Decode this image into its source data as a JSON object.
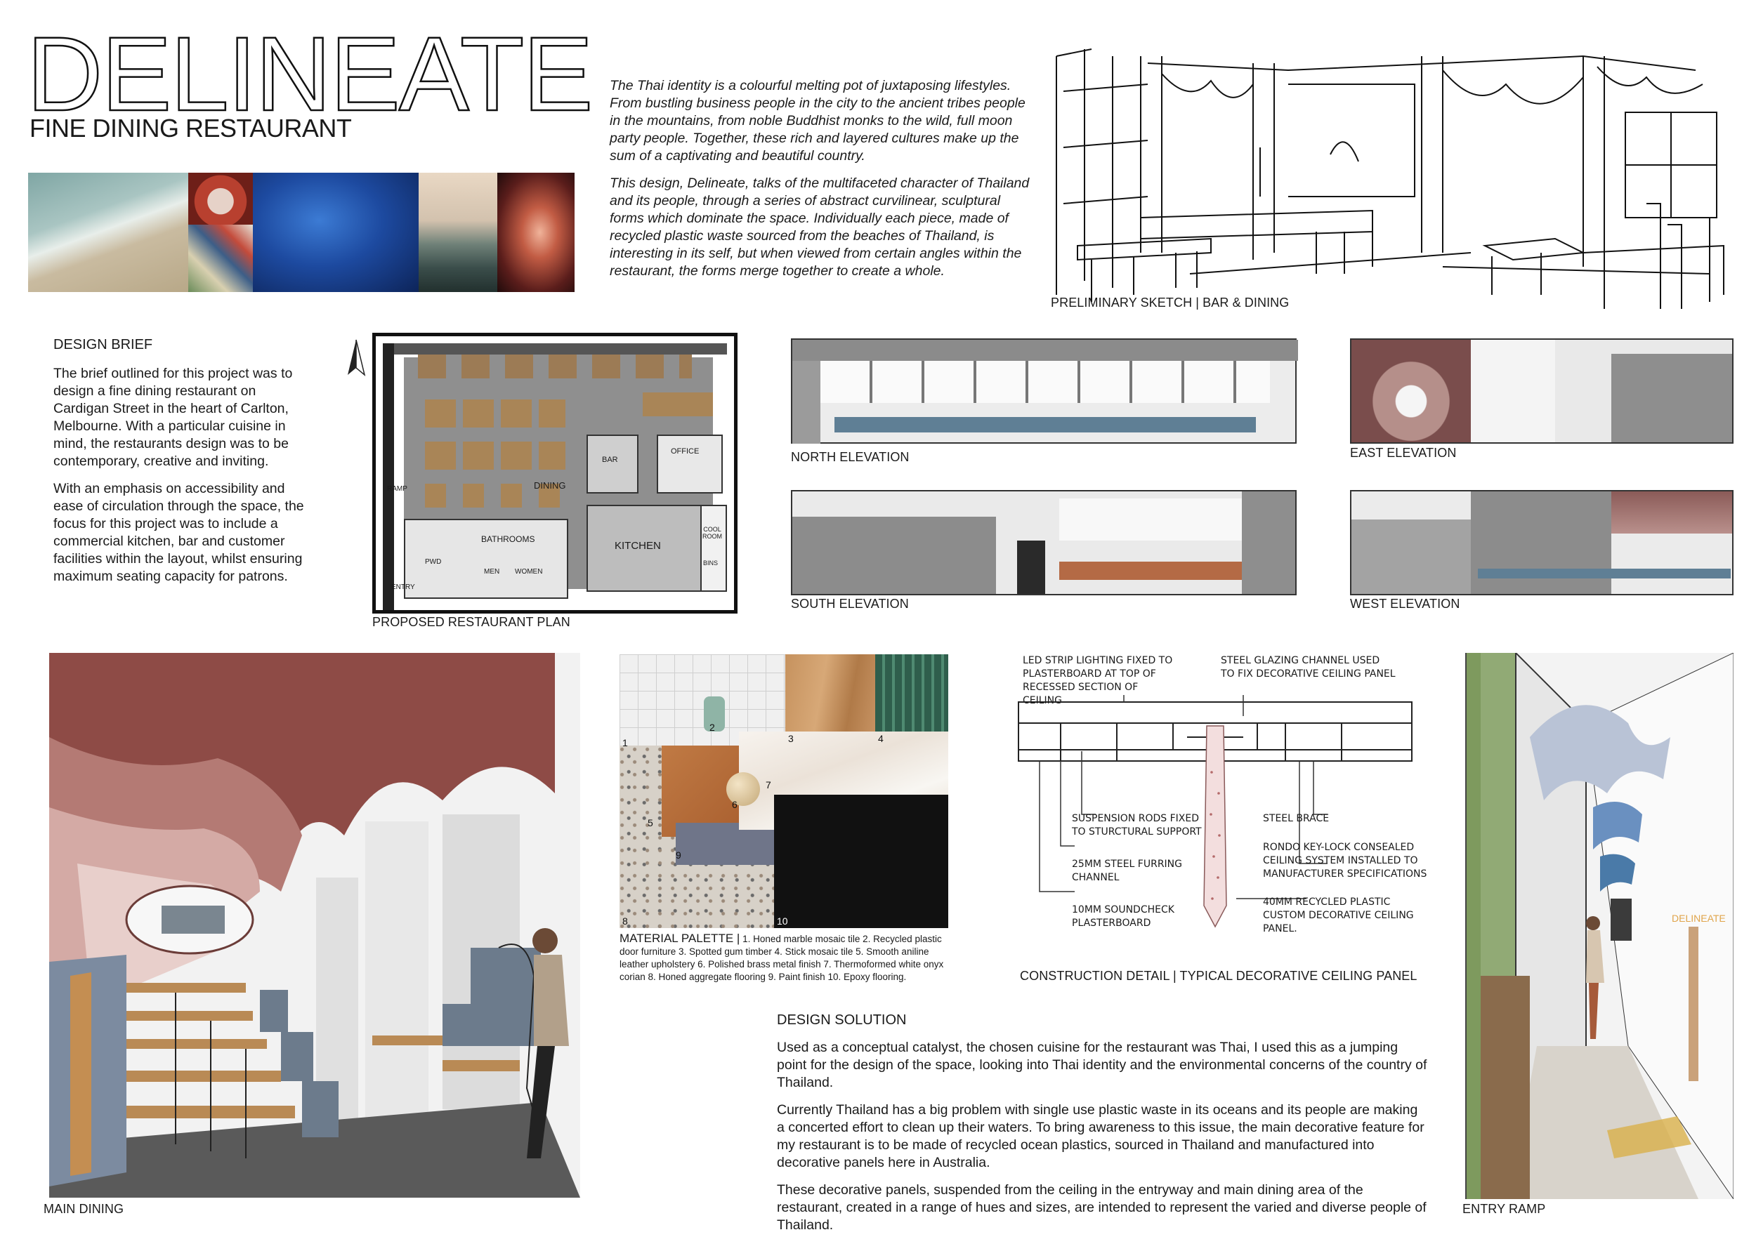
{
  "header": {
    "title": "DELINEATE",
    "subtitle": "FINE DINING RESTAURANT"
  },
  "intro": {
    "p1": "The Thai identity is a colourful melting pot of juxtaposing lifestyles. From bustling business people in the city to the ancient tribes people in the mountains, from noble Buddhist monks to the wild, full moon party people. Together, these rich and layered cultures make up the sum of a captivating and beautiful country.",
    "p2": "This design, Delineate, talks of the multifaceted character of Thailand and its people, through a series of abstract curvilinear, sculptural forms which dominate the space. Individually each piece, made of recycled plastic waste sourced from the beaches of Thailand, is interesting in its self, but when viewed from certain angles within the restaurant, the forms merge together to create a whole."
  },
  "captions": {
    "sketch": "PRELIMINARY SKETCH | BAR & DINING",
    "plan": "PROPOSED RESTAURANT PLAN",
    "north": "NORTH ELEVATION",
    "east": "EAST ELEVATION",
    "south": "SOUTH ELEVATION",
    "west": "WEST ELEVATION",
    "main_dining": "MAIN DINING",
    "entry_ramp": "ENTRY RAMP",
    "construction": "CONSTRUCTION DETAIL | TYPICAL DECORATIVE CEILING PANEL"
  },
  "brief": {
    "heading": "DESIGN BRIEF",
    "p1": "The brief outlined for this project was to design a fine dining restaurant on Cardigan Street in the heart of Carlton, Melbourne. With a particular cuisine in mind, the restaurants design was to be contemporary, creative and inviting.",
    "p2": "With an emphasis on accessibility and ease of circulation through the space, the focus for this project was to include a commercial kitchen, bar and customer facilities within the layout, whilst ensuring maximum seating capacity for patrons."
  },
  "plan_labels": {
    "bar": "BAR",
    "office": "OFFICE",
    "dining": "DINING",
    "ramp": "RAMP",
    "bathrooms": "BATHROOMS",
    "kitchen": "KITCHEN",
    "pwd": "PWD",
    "men": "MEN",
    "women": "WOMEN",
    "entry": "ENTRY",
    "coolroom": "COOL ROOM",
    "bins": "BINS"
  },
  "materials": {
    "heading": "MATERIAL PALETTE |",
    "text": "1. Honed marble mosaic tile 2. Recycled plastic door furniture 3. Spotted gum timber 4. Stick mosaic tile 5. Smooth aniline leather upholstery 6. Polished brass metal finish 7. Thermoformed white onyx corian 8. Honed aggregate flooring 9. Paint finish 10. Epoxy flooring.",
    "numbers": [
      "1",
      "2",
      "3",
      "4",
      "5",
      "6",
      "7",
      "8",
      "9",
      "10"
    ]
  },
  "construction_notes": {
    "led": "LED STRIP LIGHTING FIXED TO PLASTERBOARD AT TOP OF RECESSED SECTION OF CEILING",
    "steel_channel": "STEEL GLAZING CHANNEL USED TO FIX DECORATIVE CEILING PANEL",
    "suspension": "SUSPENSION RODS FIXED TO STURCTURAL SUPPORT",
    "furring": "25MM STEEL FURRING CHANNEL",
    "soundcheck": "10MM SOUNDCHECK PLASTERBOARD",
    "brace": "STEEL BRACE",
    "rondo": "RONDO KEY-LOCK CONSEALED CEILING SYSTEM INSTALLED TO MANUFACTURER SPECIFICATIONS",
    "recycled": "40MM RECYCLED PLASTIC CUSTOM DECORATIVE CEILING PANEL."
  },
  "solution": {
    "heading": "DESIGN SOLUTION",
    "p1": "Used as a conceptual catalyst, the chosen cuisine for the restaurant was Thai, I used this as a jumping point for the design of the space, looking into Thai identity and the environmental concerns of the country of Thailand.",
    "p2": "Currently Thailand has a big problem with single use plastic waste in its oceans and its people are making a concerted effort to clean up their waters. To bring awareness to this issue, the main decorative feature for my restaurant is to be made of recycled ocean plastics, sourced in Thailand and manufactured into decorative panels here in Australia.",
    "p3": "These decorative panels, suspended from the ceiling in the entryway and main dining area of the restaurant, created in a range of hues and sizes, are intended to represent the varied and diverse people of Thailand."
  },
  "entry_sign": "DELINEATE"
}
